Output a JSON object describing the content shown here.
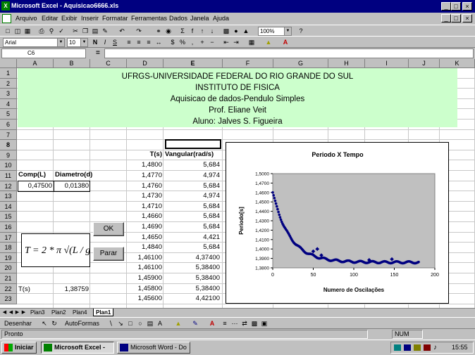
{
  "window": {
    "title": "Microsoft Excel - Aquisicao6666.xls",
    "controls": [
      "_",
      "□",
      "×"
    ],
    "doc_controls": [
      "_",
      "□",
      "×"
    ]
  },
  "menu": [
    "Arquivo",
    "Editar",
    "Exibir",
    "Inserir",
    "Formatar",
    "Ferramentas",
    "Dados",
    "Janela",
    "Ajuda"
  ],
  "toolbar": {
    "zoom": "100%",
    "font": "Arial",
    "font_size": "10",
    "bold": "N",
    "italic": "I",
    "underline": "S"
  },
  "formula_bar": {
    "name_box": "C6",
    "equals": "="
  },
  "columns": [
    "A",
    "B",
    "C",
    "D",
    "E",
    "F",
    "G",
    "H",
    "I",
    "J",
    "K"
  ],
  "rows": [
    "1",
    "2",
    "3",
    "4",
    "5",
    "6",
    "7",
    "8",
    "9",
    "10",
    "11",
    "12",
    "13",
    "14",
    "15",
    "16",
    "17",
    "18",
    "19",
    "20",
    "21",
    "22",
    "23"
  ],
  "banner": {
    "line1": "UFRGS-UNIVERSIDADE FEDERAL DO RIO GRANDE DO SUL",
    "line2": "INSTITUTO DE FISICA",
    "line3": "Aquisicao de dados-Pendulo Simples",
    "line4": "Prof. Eliane Veit",
    "line5": "Aluno: Jalves S. Figueira"
  },
  "cells": {
    "d9": "T(s)",
    "e9": "Vangular(rad/s)",
    "a11": "Comp(L)",
    "b11": "Diametro(d)",
    "a12": "0,47500",
    "b12": "0,01380",
    "a22": "T(s)",
    "b22": "1,38759"
  },
  "data_col_d": [
    "1,4800",
    "1,4770",
    "1,4760",
    "1,4730",
    "1,4710",
    "1,4660",
    "1,4690",
    "1,4650",
    "1,4840",
    "1,46100",
    "1,46100",
    "1,45900",
    "1,45800",
    "1,45600"
  ],
  "data_col_e": [
    "5,684",
    "4,974",
    "5,684",
    "4,974",
    "5,684",
    "5,684",
    "5,684",
    "4,421",
    "5,684",
    "4,37400",
    "5,38400",
    "5,38400",
    "5,38400",
    "4,42100"
  ],
  "buttons": {
    "ok": "OK",
    "parar": "Parar"
  },
  "formula_image": {
    "text": "T = 2 * π √(L / g)"
  },
  "chart_data": {
    "type": "scatter",
    "title": "Periodo X Tempo",
    "xlabel": "Numero de Oscilações",
    "ylabel": "Periodo[s]",
    "xlim": [
      0,
      200
    ],
    "ylim": [
      1.38,
      1.5
    ],
    "xticks": [
      "0",
      "50",
      "100",
      "150",
      "200"
    ],
    "yticks": [
      "1,3800",
      "1,3900",
      "1,4000",
      "1,4100",
      "1,4200",
      "1,4300",
      "1,4400",
      "1,4500",
      "1,4600",
      "1,4700",
      "1,5000"
    ],
    "plot_background": "#c0c0c0",
    "marker_color": "#000080",
    "series_model": {
      "asymptote": 1.387,
      "amplitude": 0.089,
      "decay": 0.047,
      "n_points": 180
    },
    "outliers": [
      [
        50,
        1.401
      ],
      [
        55,
        1.404
      ],
      [
        60,
        1.396
      ],
      [
        119,
        1.39
      ],
      [
        147,
        1.391
      ]
    ]
  },
  "sheet_tabs": [
    "Plan3",
    "Plan2",
    "Plan4",
    "Plan1"
  ],
  "active_tab": "Plan1",
  "draw_toolbar": {
    "draw": "Desenhar",
    "autoshapes": "AutoFormas"
  },
  "status": {
    "ready": "Pronto",
    "num": "NUM"
  },
  "taskbar": {
    "start": "Iniciar",
    "tasks": [
      "Microsoft Excel -",
      "Microsoft Word - Do"
    ],
    "clock": "15:55"
  }
}
